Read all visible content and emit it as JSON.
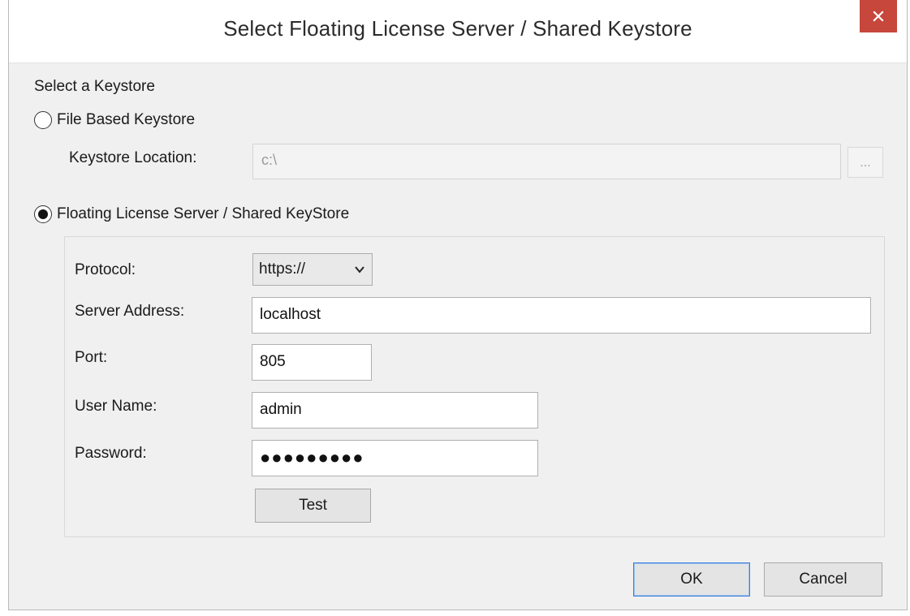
{
  "window": {
    "title": "Select Floating License Server / Shared Keystore"
  },
  "keystore": {
    "section_label": "Select a Keystore",
    "file_based": {
      "label": "File Based Keystore",
      "selected": false,
      "location_label": "Keystore Location:",
      "location_value": "c:\\",
      "browse_label": "..."
    },
    "floating": {
      "label": "Floating License Server / Shared KeyStore",
      "selected": true
    }
  },
  "server": {
    "protocol_label": "Protocol:",
    "protocol_value": "https://",
    "address_label": "Server Address:",
    "address_value": "localhost",
    "port_label": "Port:",
    "port_value": "805",
    "user_label": "User Name:",
    "user_value": "admin",
    "password_label": "Password:",
    "password_mask": "●●●●●●●●●",
    "test_label": "Test"
  },
  "footer": {
    "ok_label": "OK",
    "cancel_label": "Cancel"
  },
  "icons": {
    "close": "close-icon",
    "dropdown": "chevron-down-icon"
  },
  "colors": {
    "close_button": "#c7473c",
    "window_bg": "#f0f0f0",
    "default_button_border": "#3c7fd9"
  }
}
